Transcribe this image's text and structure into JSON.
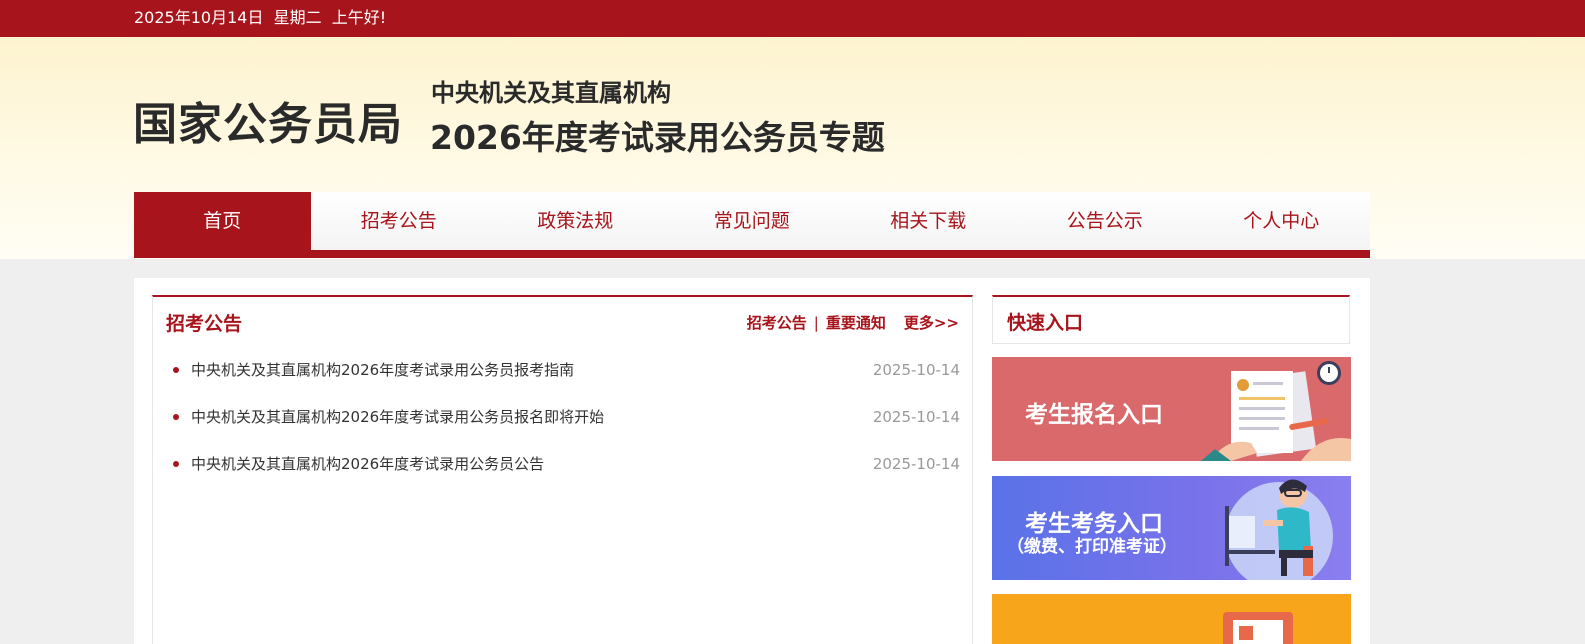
{
  "topbar": {
    "greeting": "2025年10月14日  星期二  上午好!"
  },
  "header": {
    "org_name": "国家公务员局",
    "title_line1": "中央机关及其直属机构",
    "title_line2": "2026年度考试录用公务员专题"
  },
  "nav": {
    "items": [
      {
        "label": "首页",
        "active": true
      },
      {
        "label": "招考公告"
      },
      {
        "label": "政策法规"
      },
      {
        "label": "常见问题"
      },
      {
        "label": "相关下载"
      },
      {
        "label": "公告公示"
      },
      {
        "label": "个人中心"
      }
    ]
  },
  "announcements": {
    "title": "招考公告",
    "links": {
      "notices": "招考公告",
      "separator": "|",
      "important": "重要通知",
      "more": "更多>>"
    },
    "items": [
      {
        "title": "中央机关及其直属机构2026年度考试录用公务员报考指南",
        "date": "2025-10-14"
      },
      {
        "title": "中央机关及其直属机构2026年度考试录用公务员报名即将开始",
        "date": "2025-10-14"
      },
      {
        "title": "中央机关及其直属机构2026年度考试录用公务员公告",
        "date": "2025-10-14"
      }
    ]
  },
  "quick_entry": {
    "title": "快速入口",
    "entries": [
      {
        "label": "考生报名入口",
        "sub": "",
        "color": "#d9696b",
        "icon": "application-form-icon"
      },
      {
        "label": "考生考务入口",
        "sub": "（缴费、打印准考证）",
        "color": "#6a72ea",
        "icon": "computer-user-icon"
      },
      {
        "label": "",
        "sub": "",
        "color": "#f7a51a",
        "icon": "document-icon"
      }
    ]
  },
  "colors": {
    "brand_red": "#a8141b",
    "header_bg": "#fdf3cf",
    "page_bg": "#efefef"
  }
}
